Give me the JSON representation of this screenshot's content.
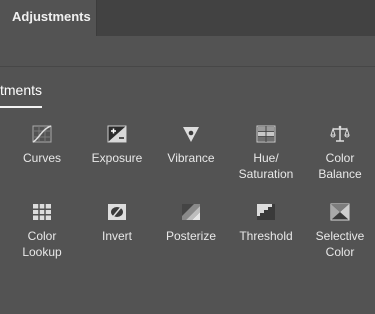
{
  "header": {
    "tab_label": "Adjustments"
  },
  "section": {
    "tab_label": "tments"
  },
  "adjustments": [
    {
      "label": "Curves",
      "icon": "curves-icon"
    },
    {
      "label": "Exposure",
      "icon": "exposure-icon"
    },
    {
      "label": "Vibrance",
      "icon": "vibrance-icon"
    },
    {
      "label": "Hue/\nSaturation",
      "icon": "hue-saturation-icon"
    },
    {
      "label": "Color\nBalance",
      "icon": "color-balance-icon"
    },
    {
      "label": "Color\nLookup",
      "icon": "color-lookup-icon"
    },
    {
      "label": "Invert",
      "icon": "invert-icon"
    },
    {
      "label": "Posterize",
      "icon": "posterize-icon"
    },
    {
      "label": "Threshold",
      "icon": "threshold-icon"
    },
    {
      "label": "Selective\nColor",
      "icon": "selective-color-icon"
    }
  ]
}
